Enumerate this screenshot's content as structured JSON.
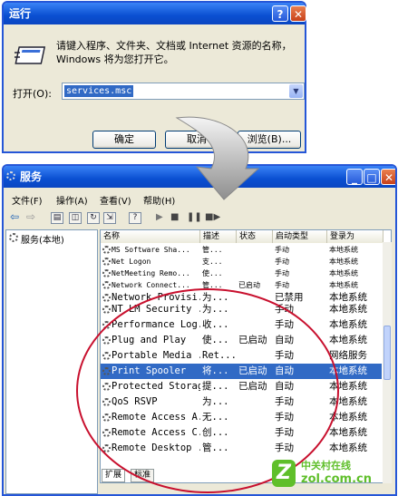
{
  "run_dialog": {
    "title": "运行",
    "help_btn": "?",
    "close_btn": "✕",
    "description": "请键入程序、文件夹、文档或 Internet 资源的名称，Windows 将为您打开它。",
    "open_label": "打开(O):",
    "open_value": "services.msc",
    "ok": "确定",
    "cancel": "取消",
    "browse": "浏览(B)..."
  },
  "services_window": {
    "title": "服务",
    "menu": [
      "文件(F)",
      "操作(A)",
      "查看(V)",
      "帮助(H)"
    ],
    "tree_item": "服务(本地)",
    "columns": [
      "名称",
      "描述",
      "状态",
      "启动类型",
      "登录为"
    ],
    "rows": [
      {
        "name": "MS Software Sha...",
        "desc": "管...",
        "status": "",
        "startup": "手动",
        "logon": "本地系统"
      },
      {
        "name": "Net Logon",
        "desc": "支...",
        "status": "",
        "startup": "手动",
        "logon": "本地系统"
      },
      {
        "name": "NetMeeting Remo...",
        "desc": "使...",
        "status": "",
        "startup": "手动",
        "logon": "本地系统"
      },
      {
        "name": "Network Connect...",
        "desc": "管...",
        "status": "已启动",
        "startup": "手动",
        "logon": "本地系统"
      },
      {
        "name": "Network Provisi...",
        "desc": "为...",
        "status": "",
        "startup": "已禁用",
        "logon": "本地系统"
      },
      {
        "name": "NT LM Security ...",
        "desc": "为...",
        "status": "",
        "startup": "手动",
        "logon": "本地系统"
      },
      {
        "name": "Performance Log...",
        "desc": "收...",
        "status": "",
        "startup": "手动",
        "logon": "本地系统"
      },
      {
        "name": "Plug and Play",
        "desc": "使...",
        "status": "已启动",
        "startup": "自动",
        "logon": "本地系统"
      },
      {
        "name": "Portable Media ...",
        "desc": "Ret...",
        "status": "",
        "startup": "手动",
        "logon": "网络服务"
      },
      {
        "name": "Print Spooler",
        "desc": "将...",
        "status": "已启动",
        "startup": "自动",
        "logon": "本地系统"
      },
      {
        "name": "Protected Storage",
        "desc": "提...",
        "status": "已启动",
        "startup": "自动",
        "logon": "本地系统"
      },
      {
        "name": "QoS RSVP",
        "desc": "为...",
        "status": "",
        "startup": "手动",
        "logon": "本地系统"
      },
      {
        "name": "Remote Access A...",
        "desc": "无...",
        "status": "",
        "startup": "手动",
        "logon": "本地系统"
      },
      {
        "name": "Remote Access C...",
        "desc": "创...",
        "status": "",
        "startup": "手动",
        "logon": "本地系统"
      },
      {
        "name": "Remote Desktop ...",
        "desc": "管...",
        "status": "",
        "startup": "手动",
        "logon": "本地系统"
      }
    ],
    "tabs": [
      "扩展",
      "标准"
    ]
  },
  "watermark": {
    "brand": "中关村在线",
    "url": "zol.com.cn"
  },
  "colors": {
    "title_blue": "#0a4fd1",
    "selection": "#316ac5",
    "loupe": "#c8102e",
    "dialog_bg": "#ece9d8"
  }
}
